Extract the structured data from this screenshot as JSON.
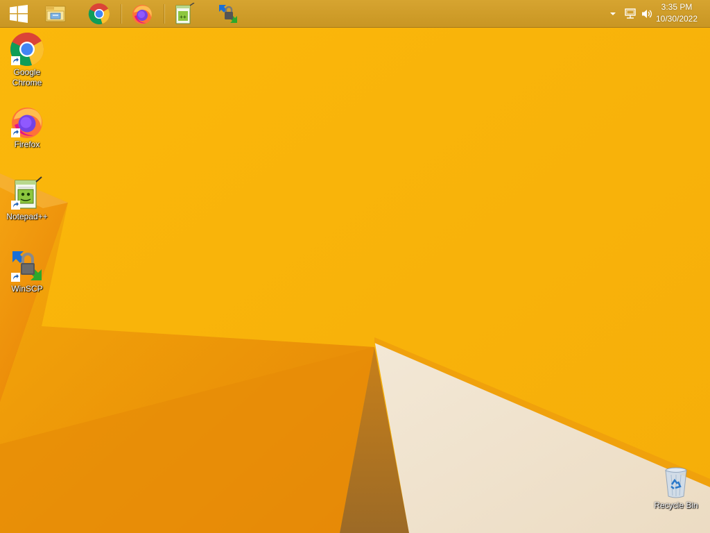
{
  "taskbar": {
    "start_button": "windows-logo-icon",
    "pinned": [
      {
        "name": "file-explorer",
        "icon": "file-explorer-icon"
      },
      {
        "name": "google-chrome",
        "icon": "chrome-icon"
      },
      {
        "name": "firefox",
        "icon": "firefox-icon"
      },
      {
        "name": "notepad-plus-plus",
        "icon": "notepad-plus-plus-icon"
      },
      {
        "name": "winscp",
        "icon": "winscp-icon"
      }
    ],
    "tray": {
      "icons": [
        "show-hidden-icons-chevron",
        "network-icon",
        "volume-icon"
      ],
      "time": "3:35 PM",
      "date": "10/30/2022"
    }
  },
  "desktop": {
    "icons": [
      {
        "label": "Google\nChrome",
        "label_text": "Google Chrome",
        "icon": "chrome-icon"
      },
      {
        "label_text": "Firefox",
        "icon": "firefox-icon"
      },
      {
        "label_text": "Notepad++",
        "icon": "notepad-plus-plus-icon"
      },
      {
        "label_text": "WinSCP",
        "icon": "winscp-icon"
      },
      {
        "label_text": "Recycle Bin",
        "icon": "recycle-bin-icon"
      }
    ]
  },
  "colors": {
    "wallpaper_main": "#f9b40a",
    "wallpaper_dark": "#ea8a08",
    "wallpaper_light": "#f3e6cf",
    "taskbar": "#d1a02b"
  }
}
